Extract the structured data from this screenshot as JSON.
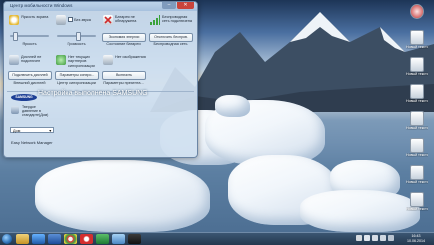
{
  "window": {
    "title": "Центр мобильности Windows",
    "min": "–",
    "close": "✕"
  },
  "tiles": {
    "brightness": {
      "label": "Яркость экрана",
      "caption": "Яркость",
      "level": 0.08
    },
    "volume": {
      "label": "Без звука",
      "caption": "Громкость",
      "level": 0.55
    },
    "battery": {
      "label": "Батарея не обнаружена",
      "button": "Экономия энергии",
      "caption": "Состояние батареи"
    },
    "wireless": {
      "label": "Беспроводная сеть подключена",
      "button": "Отключить беспров.",
      "caption": "Беспроводная сеть"
    },
    "display": {
      "label": "Дисплей не подключен",
      "button": "Подключить дисплей",
      "caption": "Внешний дисплей"
    },
    "sync": {
      "label": "Нет текущих партнеров синхронизации",
      "button": "Параметры синхро...",
      "caption": "Центр синхронизации"
    },
    "presentation": {
      "label": "Нет изображения",
      "button": "Включить",
      "caption": "Параметры презента..."
    }
  },
  "samsung": {
    "logo": "SAMSUNG",
    "text": "Твердое давление в стандарте(Дом)",
    "dropdown": "Дом",
    "manager": "Easy Network Manager"
  },
  "notification": {
    "text": "Настройка выполнена SAMSUNG"
  },
  "desktop_icons": [
    {
      "label": ""
    },
    {
      "label": "Новый текстов..."
    },
    {
      "label": "Новый текстов..."
    },
    {
      "label": "Новый текстов..."
    },
    {
      "label": "Новый текстов..."
    },
    {
      "label": "Новый текстов..."
    },
    {
      "label": "Новый текстов..."
    },
    {
      "label": "Новый текстов..."
    }
  ],
  "taskbar": {
    "apps": [
      "explorer",
      "media-player",
      "word",
      "chrome",
      "opera",
      "excel",
      "paint",
      "terminal"
    ],
    "time": "16:43",
    "date": "10.06.2014"
  },
  "colors": {
    "window_bg": "#d0e0f0",
    "title_bg": "#a7c1de",
    "taskbar": "#24384f",
    "close": "#c9443a",
    "accent": "#2b6fb5"
  }
}
